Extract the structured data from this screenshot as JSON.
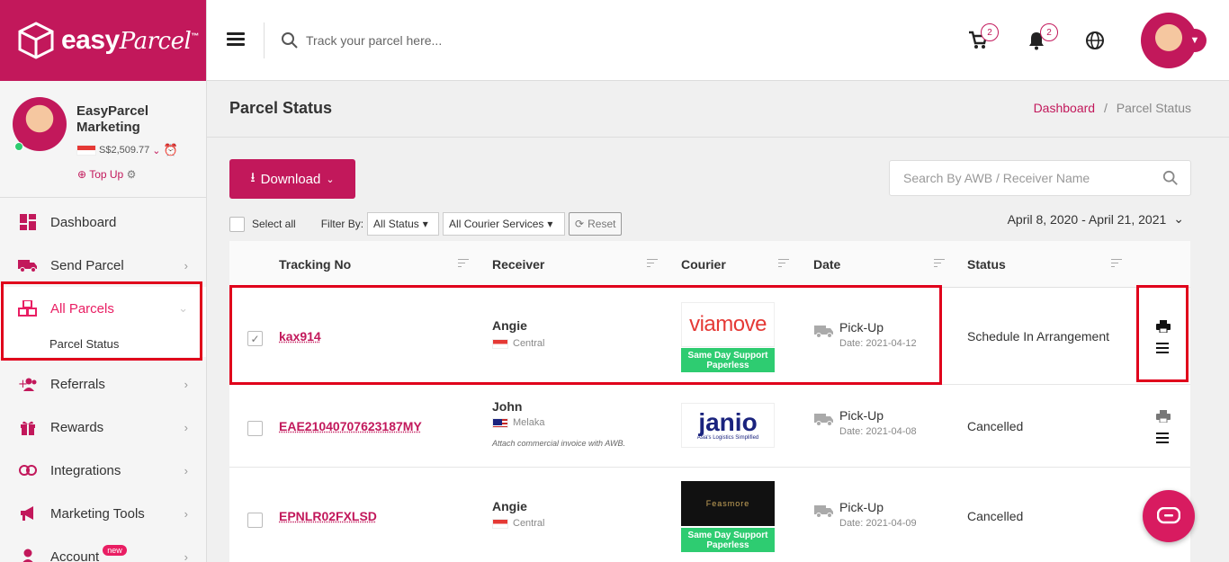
{
  "brand": {
    "logo_text": "easy",
    "logo_script": "Parcel",
    "logo_tm": "™",
    "color": "#c2185b"
  },
  "profile": {
    "name": "EasyParcel Marketing",
    "balance": "S$2,509.77",
    "topup": "Top Up"
  },
  "sidebar": {
    "items": [
      {
        "label": "Dashboard"
      },
      {
        "label": "Send Parcel"
      },
      {
        "label": "All Parcels"
      },
      {
        "label": "Referrals"
      },
      {
        "label": "Rewards"
      },
      {
        "label": "Integrations"
      },
      {
        "label": "Marketing Tools"
      },
      {
        "label": "Account"
      }
    ],
    "sub_parcel_status": "Parcel Status",
    "account_badge": "new"
  },
  "topbar": {
    "search_placeholder": "Track your parcel here...",
    "cart_count": "2",
    "notif_count": "2"
  },
  "page": {
    "title": "Parcel Status",
    "crumb_home": "Dashboard",
    "crumb_sep": "/",
    "crumb_current": "Parcel Status"
  },
  "toolbar": {
    "download_label": "Download",
    "search_placeholder": "Search By AWB / Receiver Name",
    "select_all": "Select all",
    "filter_by": "Filter By:",
    "status_filter": "All Status",
    "courier_filter": "All Courier Services",
    "reset": "Reset",
    "date_range": "April 8, 2020 - April 21, 2021"
  },
  "table": {
    "headers": [
      "Tracking No",
      "Receiver",
      "Courier",
      "Date",
      "Status"
    ],
    "rows": [
      {
        "tracking": "kax914",
        "receiver": "Angie",
        "location": "Central",
        "note": "",
        "courier": "viamove",
        "paperless": "Same Day Support Paperless",
        "type": "Pick-Up",
        "date": "Date: 2021-04-12",
        "status": "Schedule In Arrangement",
        "checked": true
      },
      {
        "tracking": "EAE21040707623187MY",
        "receiver": "John",
        "location": "Melaka",
        "note": "Attach commercial invoice with AWB.",
        "courier": "janio",
        "courier_tag": "Asia's Logistics Simplified",
        "paperless": "",
        "type": "Pick-Up",
        "date": "Date: 2021-04-08",
        "status": "Cancelled",
        "checked": false
      },
      {
        "tracking": "EPNLR02FXLSD",
        "receiver": "Angie",
        "location": "Central",
        "note": "",
        "courier": "Feasmore",
        "paperless": "Same Day Support Paperless",
        "type": "Pick-Up",
        "date": "Date: 2021-04-09",
        "status": "Cancelled",
        "checked": false
      }
    ]
  }
}
